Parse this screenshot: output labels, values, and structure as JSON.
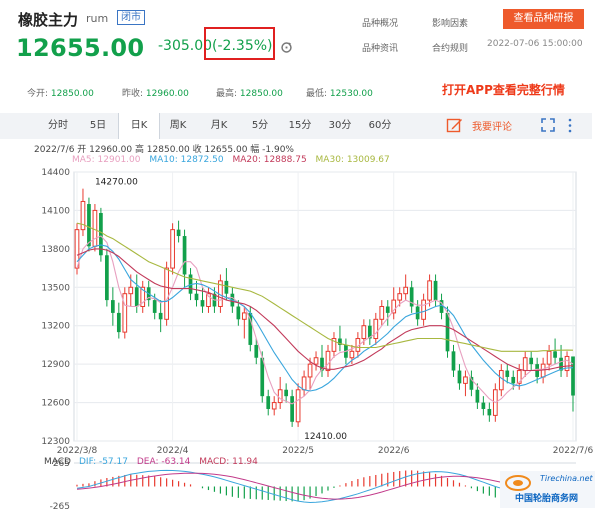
{
  "header": {
    "title": "橡胶主力",
    "code": "rum",
    "status": "闭市",
    "price": "12655.00",
    "change": "-305.00",
    "change_pct": "(-2.35%)",
    "nav": [
      "品种概况",
      "影响因素",
      "品种资讯",
      "合约规则"
    ],
    "research_button": "查看品种研报",
    "timestamp": "2022-07-06 15:00:00",
    "down_color": "#12a04b",
    "up_color": "#e83a2f",
    "highlight_color": "#e02020"
  },
  "stats": [
    {
      "label": "今开:",
      "value": "12850.00"
    },
    {
      "label": "昨收:",
      "value": "12960.00"
    },
    {
      "label": "最高:",
      "value": "12850.00"
    },
    {
      "label": "最低:",
      "value": "12530.00"
    }
  ],
  "app_link": "打开APP查看完整行情",
  "tabs": [
    "分时",
    "5日",
    "日K",
    "周K",
    "月K",
    "5分",
    "15分",
    "30分",
    "60分"
  ],
  "active_tab": "日K",
  "comment_label": "我要评论",
  "icons": {
    "comment": "edit-icon",
    "expand": "expand-icon",
    "more": "more-vertical-icon",
    "refresh": "refresh-icon"
  },
  "chart_info": {
    "ohlc": "2022/7/6  开 12960.00  高 12850.00  收 12655.00  幅 -1.90%",
    "ma": [
      {
        "text": "MA5: 12901.00",
        "color": "#e8a0c0"
      },
      {
        "text": "MA10: 12872.50",
        "color": "#3aa6dd"
      },
      {
        "text": "MA20: 12888.75",
        "color": "#c23a5a"
      },
      {
        "text": "MA30: 13009.67",
        "color": "#a8b840"
      }
    ],
    "macd_label": "MACD",
    "macd": [
      {
        "text": "DIF: -57.17",
        "color": "#3aa6dd"
      },
      {
        "text": "DEA: -63.14",
        "color": "#c23a8a"
      },
      {
        "text": "MACD: 11.94",
        "color": "#c23a5a"
      }
    ]
  },
  "chart_data": {
    "type": "candlestick",
    "y_ticks": [
      14400,
      14100,
      13800,
      13500,
      13200,
      12900,
      12600,
      12300
    ],
    "ylim": [
      12300,
      14400
    ],
    "x_tick_labels": [
      {
        "label": "2022/3/8",
        "index": 0
      },
      {
        "label": "2022/4",
        "index": 16
      },
      {
        "label": "2022/5",
        "index": 37
      },
      {
        "label": "2022/6",
        "index": 53
      },
      {
        "label": "2022/7/6",
        "index": 83
      }
    ],
    "annotations": [
      {
        "label": "14270.00",
        "index": 2,
        "value": 14270,
        "pos": "above"
      },
      {
        "label": "12410.00",
        "index": 37,
        "value": 12410,
        "pos": "below"
      }
    ],
    "candles": [
      [
        13650,
        13950,
        13600,
        14000
      ],
      [
        13950,
        14170,
        13900,
        14270
      ],
      [
        14150,
        13820,
        13780,
        14200
      ],
      [
        13820,
        14100,
        13780,
        14150
      ],
      [
        14080,
        13750,
        13700,
        14120
      ],
      [
        13750,
        13400,
        13350,
        13800
      ],
      [
        13400,
        13300,
        13200,
        13500
      ],
      [
        13300,
        13150,
        13100,
        13380
      ],
      [
        13150,
        13450,
        13100,
        13500
      ],
      [
        13450,
        13500,
        13350,
        13600
      ],
      [
        13500,
        13350,
        13300,
        13600
      ],
      [
        13350,
        13500,
        13300,
        13550
      ],
      [
        13500,
        13400,
        13350,
        13550
      ],
      [
        13400,
        13300,
        13250,
        13450
      ],
      [
        13300,
        13250,
        13150,
        13400
      ],
      [
        13250,
        13650,
        13200,
        13700
      ],
      [
        13650,
        13950,
        13600,
        14000
      ],
      [
        13950,
        13900,
        13850,
        14020
      ],
      [
        13900,
        13600,
        13500,
        13950
      ],
      [
        13600,
        13450,
        13400,
        13650
      ],
      [
        13450,
        13400,
        13350,
        13550
      ],
      [
        13400,
        13350,
        13300,
        13500
      ],
      [
        13350,
        13450,
        13300,
        13500
      ],
      [
        13450,
        13350,
        13300,
        13500
      ],
      [
        13350,
        13550,
        13300,
        13600
      ],
      [
        13550,
        13450,
        13400,
        13650
      ],
      [
        13450,
        13350,
        13300,
        13500
      ],
      [
        13350,
        13250,
        13200,
        13400
      ],
      [
        13250,
        13300,
        13100,
        13350
      ],
      [
        13300,
        13050,
        13000,
        13350
      ],
      [
        13050,
        12950,
        12900,
        13100
      ],
      [
        12950,
        12650,
        12600,
        13000
      ],
      [
        12650,
        12550,
        12500,
        12700
      ],
      [
        12550,
        12600,
        12500,
        12650
      ],
      [
        12600,
        12700,
        12550,
        12800
      ],
      [
        12700,
        12650,
        12600,
        12750
      ],
      [
        12650,
        12450,
        12410,
        12700
      ],
      [
        12450,
        12700,
        12410,
        12750
      ],
      [
        12700,
        12800,
        12650,
        12850
      ],
      [
        12800,
        12900,
        12700,
        12950
      ],
      [
        12900,
        12950,
        12850,
        13000
      ],
      [
        12950,
        12850,
        12800,
        13050
      ],
      [
        12850,
        13000,
        12800,
        13050
      ],
      [
        13000,
        13100,
        12950,
        13150
      ],
      [
        13100,
        13050,
        13000,
        13200
      ],
      [
        13050,
        12950,
        12900,
        13100
      ],
      [
        12950,
        13000,
        12900,
        13050
      ],
      [
        13000,
        13100,
        12950,
        13150
      ],
      [
        13100,
        13200,
        13050,
        13250
      ],
      [
        13200,
        13100,
        13050,
        13250
      ],
      [
        13100,
        13250,
        13050,
        13300
      ],
      [
        13250,
        13350,
        13200,
        13400
      ],
      [
        13350,
        13300,
        13200,
        13400
      ],
      [
        13300,
        13400,
        13250,
        13500
      ],
      [
        13400,
        13450,
        13350,
        13500
      ],
      [
        13450,
        13500,
        13400,
        13600
      ],
      [
        13500,
        13350,
        13300,
        13550
      ],
      [
        13350,
        13250,
        13200,
        13400
      ],
      [
        13250,
        13400,
        13200,
        13450
      ],
      [
        13400,
        13550,
        13350,
        13600
      ],
      [
        13550,
        13400,
        13350,
        13600
      ],
      [
        13400,
        13300,
        13250,
        13450
      ],
      [
        13300,
        13000,
        12950,
        13350
      ],
      [
        13000,
        12850,
        12800,
        13050
      ],
      [
        12850,
        12750,
        12700,
        12900
      ],
      [
        12750,
        12800,
        12650,
        12850
      ],
      [
        12800,
        12700,
        12650,
        12850
      ],
      [
        12700,
        12600,
        12550,
        12750
      ],
      [
        12600,
        12550,
        12500,
        12650
      ],
      [
        12550,
        12500,
        12450,
        12600
      ],
      [
        12500,
        12700,
        12450,
        12750
      ],
      [
        12700,
        12850,
        12650,
        12900
      ],
      [
        12850,
        12800,
        12750,
        12900
      ],
      [
        12800,
        12750,
        12700,
        12850
      ],
      [
        12750,
        12850,
        12700,
        12900
      ],
      [
        12850,
        12950,
        12800,
        13000
      ],
      [
        12950,
        12900,
        12850,
        13000
      ],
      [
        12900,
        12800,
        12750,
        12950
      ],
      [
        12800,
        12900,
        12750,
        12950
      ],
      [
        12900,
        13000,
        12850,
        13050
      ],
      [
        13000,
        12950,
        12900,
        13100
      ],
      [
        12950,
        12850,
        12800,
        13050
      ],
      [
        12850,
        12960,
        12800,
        13000
      ],
      [
        12960,
        12655,
        12530,
        12850
      ]
    ],
    "ma_series": [
      {
        "name": "MA5",
        "color": "#e8a0c0",
        "values": [
          13650,
          13800,
          13850,
          13880,
          13900,
          13850,
          13700,
          13500,
          13360,
          13350,
          13350,
          13380,
          13420,
          13410,
          13380,
          13400,
          13500,
          13620,
          13700,
          13700,
          13650,
          13500,
          13430,
          13400,
          13400,
          13420,
          13420,
          13380,
          13350,
          13250,
          13100,
          12950,
          12800,
          12680,
          12630,
          12610,
          12590,
          12620,
          12650,
          12700,
          12800,
          12860,
          12900,
          12960,
          12990,
          13000,
          13020,
          13040,
          13080,
          13110,
          13140,
          13200,
          13260,
          13320,
          13370,
          13400,
          13380,
          13360,
          13360,
          13380,
          13400,
          13380,
          13300,
          13180,
          13020,
          12880,
          12780,
          12730,
          12680,
          12630,
          12600,
          12630,
          12680,
          12720,
          12760,
          12810,
          12850,
          12860,
          12860,
          12880,
          12900,
          12920,
          12930,
          12901
        ]
      },
      {
        "name": "MA10",
        "color": "#3aa6dd",
        "values": [
          13700,
          13750,
          13800,
          13820,
          13830,
          13820,
          13780,
          13720,
          13640,
          13560,
          13520,
          13480,
          13450,
          13420,
          13390,
          13390,
          13420,
          13460,
          13500,
          13520,
          13530,
          13520,
          13500,
          13470,
          13440,
          13420,
          13400,
          13380,
          13350,
          13300,
          13230,
          13150,
          13070,
          12990,
          12920,
          12850,
          12780,
          12730,
          12700,
          12690,
          12700,
          12720,
          12750,
          12790,
          12840,
          12890,
          12930,
          12960,
          13000,
          13030,
          13060,
          13100,
          13140,
          13190,
          13230,
          13270,
          13290,
          13300,
          13310,
          13330,
          13350,
          13360,
          13330,
          13280,
          13200,
          13120,
          13050,
          12990,
          12930,
          12880,
          12830,
          12790,
          12760,
          12740,
          12730,
          12740,
          12760,
          12780,
          12800,
          12820,
          12840,
          12860,
          12870,
          12872
        ]
      },
      {
        "name": "MA20",
        "color": "#c23a5a",
        "values": [
          13750,
          13770,
          13790,
          13800,
          13800,
          13790,
          13770,
          13740,
          13700,
          13660,
          13620,
          13590,
          13560,
          13530,
          13510,
          13500,
          13490,
          13490,
          13490,
          13490,
          13480,
          13470,
          13460,
          13440,
          13420,
          13400,
          13390,
          13380,
          13370,
          13350,
          13320,
          13280,
          13240,
          13200,
          13150,
          13100,
          13050,
          13000,
          12960,
          12920,
          12890,
          12870,
          12860,
          12860,
          12870,
          12880,
          12890,
          12910,
          12930,
          12960,
          12990,
          13020,
          13060,
          13090,
          13120,
          13150,
          13170,
          13180,
          13190,
          13200,
          13200,
          13200,
          13190,
          13170,
          13140,
          13110,
          13080,
          13050,
          13020,
          12990,
          12960,
          12930,
          12900,
          12880,
          12860,
          12850,
          12850,
          12850,
          12855,
          12860,
          12870,
          12880,
          12885,
          12888
        ]
      },
      {
        "name": "MA30",
        "color": "#a8b840",
        "values": [
          14000,
          13990,
          13970,
          13950,
          13930,
          13900,
          13880,
          13850,
          13820,
          13790,
          13760,
          13730,
          13700,
          13680,
          13660,
          13640,
          13620,
          13600,
          13580,
          13570,
          13560,
          13550,
          13540,
          13530,
          13520,
          13510,
          13500,
          13490,
          13480,
          13470,
          13450,
          13430,
          13400,
          13370,
          13340,
          13310,
          13280,
          13250,
          13220,
          13190,
          13160,
          13130,
          13100,
          13080,
          13060,
          13050,
          13040,
          13030,
          13030,
          13030,
          13030,
          13040,
          13050,
          13060,
          13070,
          13080,
          13090,
          13100,
          13100,
          13100,
          13100,
          13100,
          13090,
          13080,
          13070,
          13060,
          13050,
          13040,
          13030,
          13020,
          13010,
          13000,
          13000,
          13000,
          13000,
          13000,
          13000,
          13000,
          13005,
          13005,
          13008,
          13009,
          13010,
          13009
        ]
      }
    ],
    "macd_panel": {
      "y_ticks": [
        265,
        -265
      ],
      "ylim": [
        -265,
        265
      ],
      "dif": [
        -20,
        -10,
        0,
        20,
        40,
        60,
        80,
        100,
        120,
        140,
        150,
        160,
        170,
        175,
        180,
        182,
        180,
        176,
        170,
        162,
        150,
        138,
        124,
        108,
        90,
        70,
        50,
        30,
        10,
        -10,
        -30,
        -50,
        -70,
        -90,
        -110,
        -130,
        -150,
        -165,
        -175,
        -180,
        -178,
        -172,
        -162,
        -150,
        -136,
        -120,
        -102,
        -82,
        -60,
        -38,
        -15,
        10,
        35,
        60,
        85,
        108,
        128,
        144,
        156,
        164,
        168,
        166,
        160,
        150,
        136,
        118,
        96,
        72,
        48,
        24,
        0,
        -20,
        -36,
        -48,
        -56,
        -62,
        -66,
        -68,
        -68,
        -66,
        -64,
        -60,
        -58,
        -57.17
      ],
      "dea": [
        -30,
        -25,
        -18,
        -10,
        0,
        12,
        26,
        40,
        55,
        70,
        84,
        96,
        108,
        118,
        128,
        136,
        142,
        146,
        149,
        150,
        150,
        148,
        144,
        138,
        130,
        120,
        108,
        94,
        78,
        60,
        42,
        24,
        6,
        -12,
        -30,
        -48,
        -66,
        -83,
        -98,
        -112,
        -124,
        -133,
        -139,
        -142,
        -142,
        -139,
        -133,
        -124,
        -112,
        -97,
        -80,
        -62,
        -42,
        -22,
        -2,
        18,
        37,
        55,
        71,
        85,
        97,
        106,
        112,
        115,
        115,
        112,
        106,
        98,
        88,
        76,
        62,
        48,
        34,
        21,
        9,
        -2,
        -12,
        -22,
        -30,
        -38,
        -45,
        -52,
        -58,
        -63.14
      ]
    }
  }
}
